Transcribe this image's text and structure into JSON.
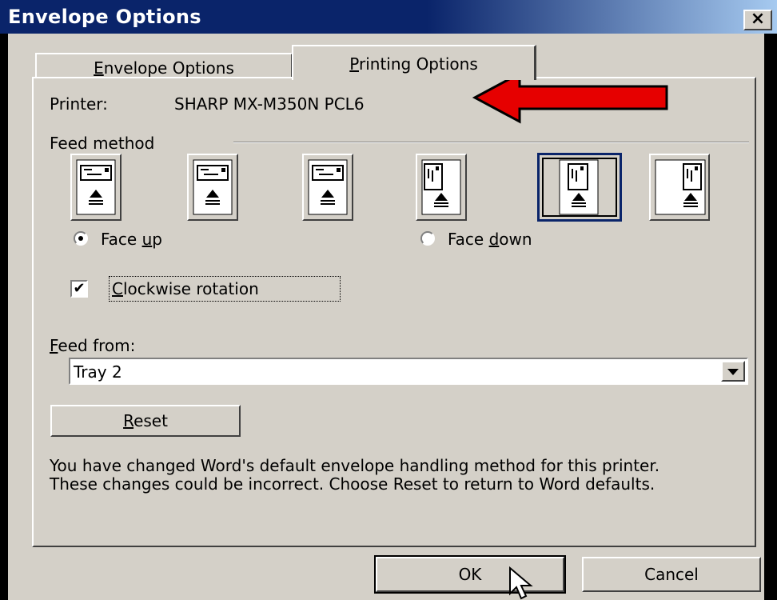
{
  "window": {
    "title": "Envelope Options",
    "close_label": "×"
  },
  "tabs": [
    {
      "label": "Envelope Options",
      "accesskey": "E",
      "active": false
    },
    {
      "label": "Printing Options",
      "accesskey": "P",
      "active": true
    }
  ],
  "printer": {
    "label": "Printer:",
    "name": "SHARP MX-M350N PCL6"
  },
  "feed_method": {
    "group_label": "Feed method",
    "selected_index": 4,
    "options_count": 6,
    "face_up_label": "Face up",
    "face_down_label": "Face down",
    "face_selected": "Face up"
  },
  "rotation": {
    "label": "Clockwise rotation",
    "checked": true,
    "check_glyph": "✔"
  },
  "feed_from": {
    "label": "Feed from:",
    "value": "Tray 2"
  },
  "buttons": {
    "reset": "Reset",
    "ok": "OK",
    "cancel": "Cancel"
  },
  "message": {
    "line1": "You have changed Word's default envelope handling method for this printer.",
    "line2": "These changes could be incorrect. Choose Reset to return to Word defaults."
  },
  "annotation": {
    "arrow_color": "#e60000"
  },
  "colors": {
    "titlebar": "#0a246a",
    "dialog_bg": "#d4d0c8"
  }
}
